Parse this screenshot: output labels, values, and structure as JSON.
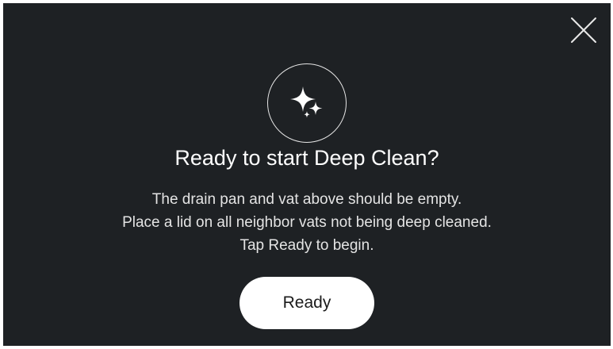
{
  "dialog": {
    "title": "Ready to start Deep Clean?",
    "lines": [
      "The drain pan and vat above should be empty.",
      "Place a lid on all neighbor vats not being deep cleaned.",
      "Tap Ready to begin."
    ],
    "primary_button": "Ready",
    "badge_icon": "sparkle-icon",
    "close_icon": "close-icon"
  },
  "colors": {
    "background": "#1e2124",
    "text": "#ffffff",
    "button_background": "#ffffff",
    "button_text": "#1b1b1b"
  }
}
